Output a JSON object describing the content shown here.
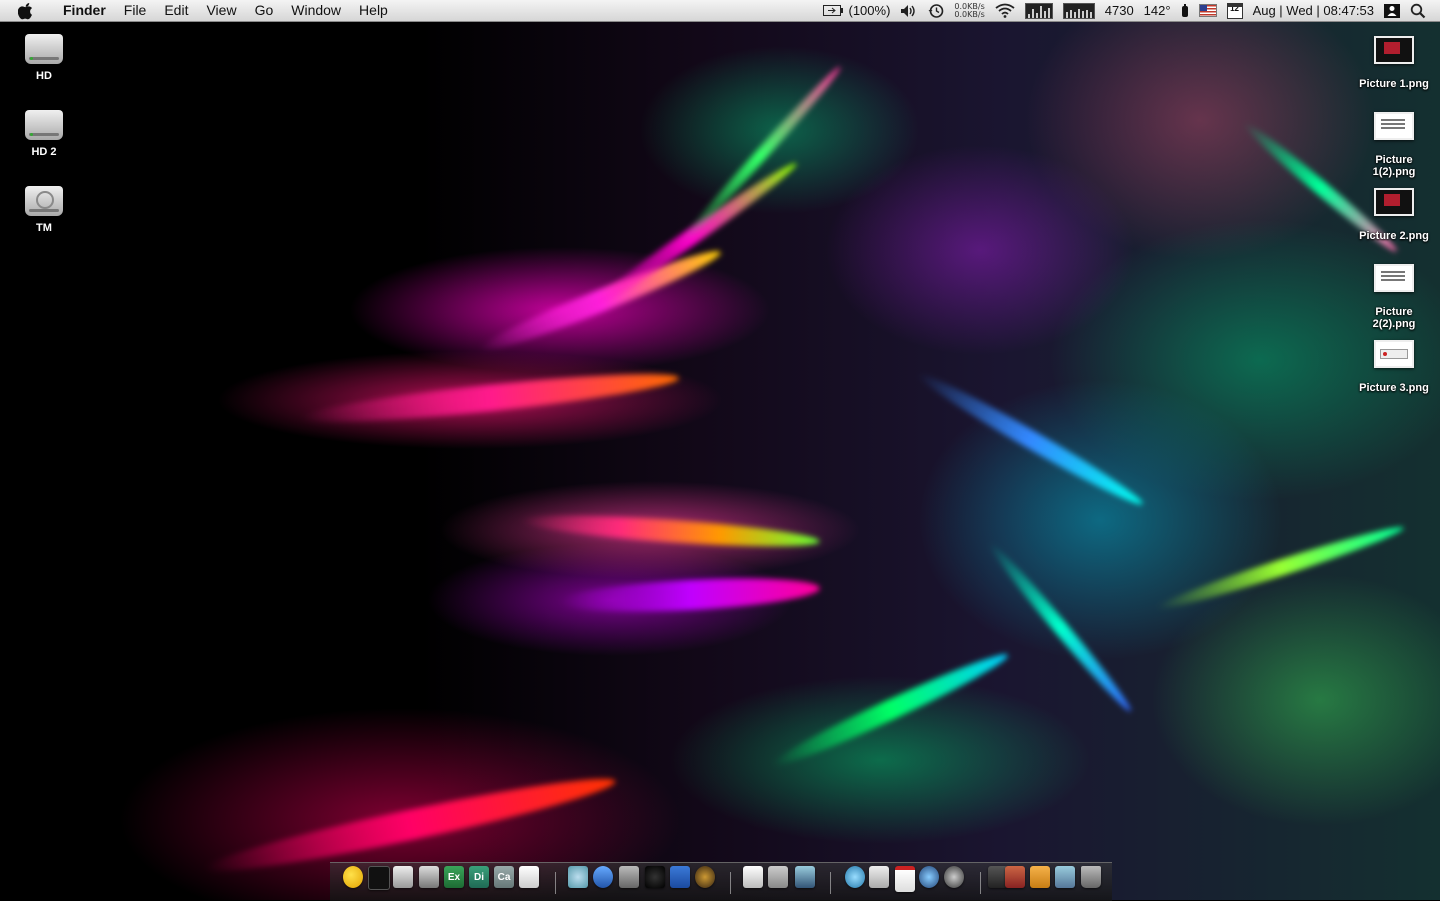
{
  "menubar": {
    "app_name": "Finder",
    "menus": [
      "File",
      "Edit",
      "View",
      "Go",
      "Window",
      "Help"
    ],
    "battery": "(100%)",
    "net_up": "0.0KB/s",
    "net_down": "0.0KB/s",
    "memory": "4730",
    "temperature": "142°",
    "calendar_day": "12",
    "datetime": "Aug | Wed | 08:47:53"
  },
  "desktop": {
    "drives": [
      {
        "label": "HD"
      },
      {
        "label": "HD 2"
      },
      {
        "label": "TM"
      }
    ],
    "files": [
      {
        "label": "Picture 1.png"
      },
      {
        "label": "Picture 1(2).png"
      },
      {
        "label": "Picture 2.png"
      },
      {
        "label": "Picture 2(2).png"
      },
      {
        "label": "Picture 3.png"
      }
    ]
  },
  "dock": {
    "apps": [
      {
        "name": "adium-icon",
        "text": ""
      },
      {
        "name": "activity-monitor-icon",
        "text": ""
      },
      {
        "name": "printer-icon",
        "text": ""
      },
      {
        "name": "scanner-icon",
        "text": ""
      },
      {
        "name": "excel-icon",
        "text": "Ex"
      },
      {
        "name": "di-app-icon",
        "text": "Di"
      },
      {
        "name": "ca-app-icon",
        "text": "Ca"
      },
      {
        "name": "script-editor-icon",
        "text": ""
      },
      {
        "name": "mail-client-icon",
        "text": ""
      },
      {
        "name": "preview-icon",
        "text": ""
      },
      {
        "name": "archive-icon",
        "text": ""
      },
      {
        "name": "camera-icon",
        "text": ""
      },
      {
        "name": "word-icon",
        "text": ""
      },
      {
        "name": "aperture-icon",
        "text": ""
      },
      {
        "name": "textedit-icon",
        "text": ""
      },
      {
        "name": "directory-utility-icon",
        "text": ""
      },
      {
        "name": "xcode-icon",
        "text": ""
      },
      {
        "name": "itunes-icon",
        "text": ""
      },
      {
        "name": "mail-icon",
        "text": ""
      },
      {
        "name": "calendar-icon",
        "text": ""
      },
      {
        "name": "safari-icon",
        "text": ""
      },
      {
        "name": "network-icon",
        "text": ""
      },
      {
        "name": "dashboard-icon",
        "text": ""
      },
      {
        "name": "books-folder-icon",
        "text": ""
      },
      {
        "name": "documents-folder-icon",
        "text": ""
      },
      {
        "name": "downloads-folder-icon",
        "text": ""
      },
      {
        "name": "trash-icon",
        "text": ""
      }
    ]
  }
}
